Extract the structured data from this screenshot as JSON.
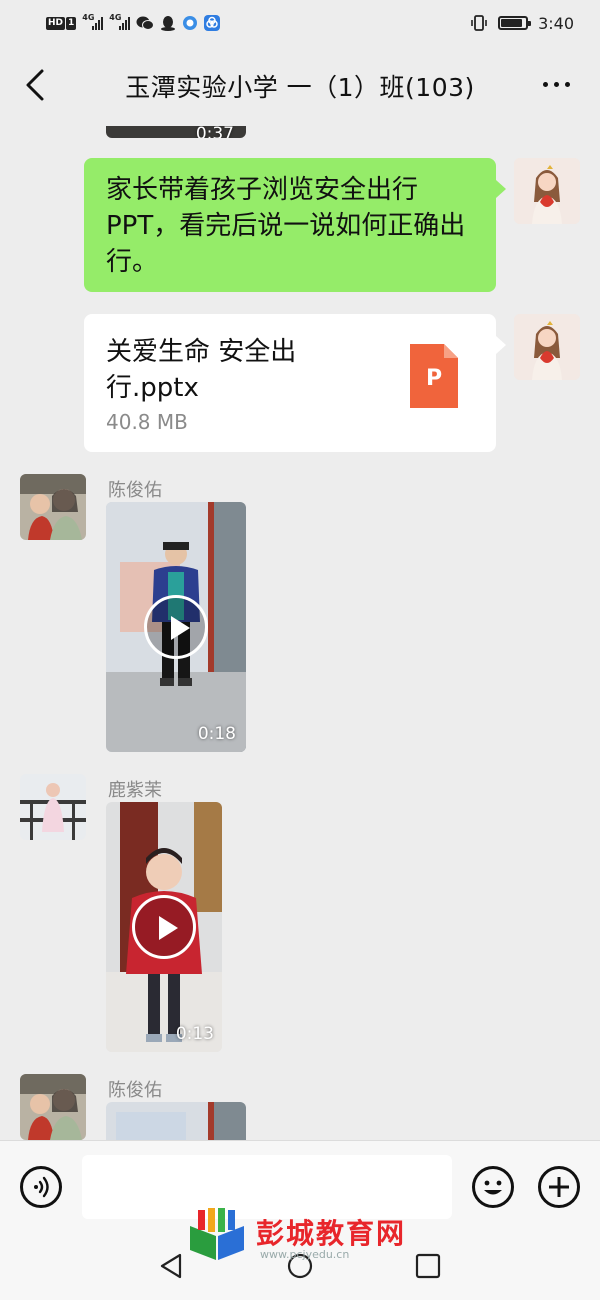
{
  "status_bar": {
    "time": "3:40",
    "left_badge_hd": "HD",
    "left_badge_sim": "1",
    "net_1": "4G",
    "net_2": "4G",
    "battery_level": 0.9
  },
  "header": {
    "title": "玉潭实验小学  一（1）班(103)"
  },
  "messages": {
    "video_top_duration": "0:37",
    "green_text": "家长带着孩子浏览安全出行PPT，看完后说一说如何正确出行。",
    "file": {
      "name": "关爱生命 安全出行.pptx",
      "size": "40.8 MB",
      "icon_letter": "P",
      "icon_color": "#f0643c"
    },
    "video_1": {
      "sender": "陈俊佑",
      "duration": "0:18"
    },
    "video_2": {
      "sender": "鹿紫茉",
      "duration": "0:13"
    },
    "video_3": {
      "sender": "陈俊佑"
    }
  },
  "input_bar": {
    "message_value": ""
  },
  "watermark": {
    "text": "彭城教育网",
    "sub": "www.pcjyedu.cn"
  },
  "colors": {
    "green_bubble": "#95ec69",
    "background": "#ededed",
    "watermark_red": "#e8262b"
  }
}
